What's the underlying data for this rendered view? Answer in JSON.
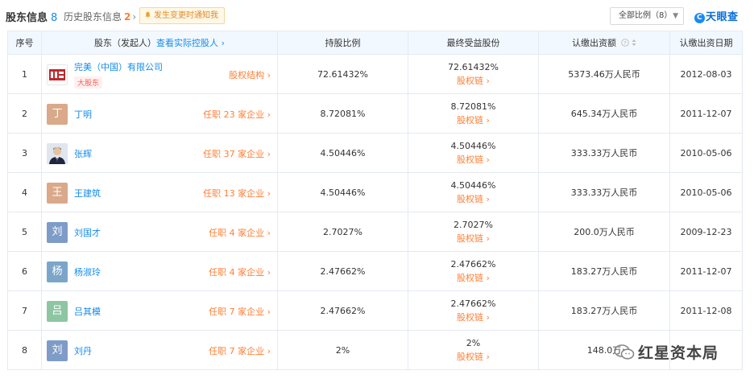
{
  "header": {
    "tab_main_label": "股东信息",
    "tab_main_count": "8",
    "tab_history_label": "历史股东信息",
    "tab_history_count": "2",
    "notify_label": "发生变更时通知我",
    "filter_label": "全部比例（8）",
    "logo_text": "天眼查"
  },
  "columns": {
    "index": "序号",
    "holder_prefix": "股东（发起人）",
    "holder_link": "查看实际控股人",
    "ratio": "持股比例",
    "beneficial": "最终受益股份",
    "capital": "认缴出资额",
    "date": "认缴出资日期"
  },
  "rows": [
    {
      "index": "1",
      "avatar": "完",
      "name": "完美（中国）有限公司",
      "tag": "大股东",
      "link": "股权结构",
      "ratio": "72.61432%",
      "benef": "72.61432%",
      "benef_link": "股权链",
      "capital": "5373.46万人民币",
      "date": "2012-08-03"
    },
    {
      "index": "2",
      "avatar": "丁",
      "name": "丁明",
      "link": "任职 23 家企业",
      "ratio": "8.72081%",
      "benef": "8.72081%",
      "benef_link": "股权链",
      "capital": "645.34万人民币",
      "date": "2011-12-07"
    },
    {
      "index": "3",
      "avatar": "",
      "name": "张辉",
      "link": "任职 37 家企业",
      "ratio": "4.50446%",
      "benef": "4.50446%",
      "benef_link": "股权链",
      "capital": "333.33万人民币",
      "date": "2010-05-06"
    },
    {
      "index": "4",
      "avatar": "王",
      "name": "王建筑",
      "link": "任职 13 家企业",
      "ratio": "4.50446%",
      "benef": "4.50446%",
      "benef_link": "股权链",
      "capital": "333.33万人民币",
      "date": "2010-05-06"
    },
    {
      "index": "5",
      "avatar": "刘",
      "name": "刘国才",
      "link": "任职 4 家企业",
      "ratio": "2.7027%",
      "benef": "2.7027%",
      "benef_link": "股权链",
      "capital": "200.0万人民币",
      "date": "2009-12-23"
    },
    {
      "index": "6",
      "avatar": "杨",
      "name": "杨淑玲",
      "link": "任职 4 家企业",
      "ratio": "2.47662%",
      "benef": "2.47662%",
      "benef_link": "股权链",
      "capital": "183.27万人民币",
      "date": "2011-12-07"
    },
    {
      "index": "7",
      "avatar": "吕",
      "name": "吕其模",
      "link": "任职 7 家企业",
      "ratio": "2.47662%",
      "benef": "2.47662%",
      "benef_link": "股权链",
      "capital": "183.27万人民币",
      "date": "2011-12-08"
    },
    {
      "index": "8",
      "avatar": "刘",
      "name": "刘丹",
      "link": "任职 7 家企业",
      "ratio": "2%",
      "benef": "2%",
      "benef_link": "股权链",
      "capital": "148.0万",
      "date": ""
    }
  ],
  "avatar_colors": [
    "#ffffff",
    "#d9a98a",
    "#dfe6ee",
    "#d9a98a",
    "#7f9cc8",
    "#7ba6c9",
    "#8ec6a4",
    "#7f9cc8"
  ],
  "watermark": "红星资本局"
}
